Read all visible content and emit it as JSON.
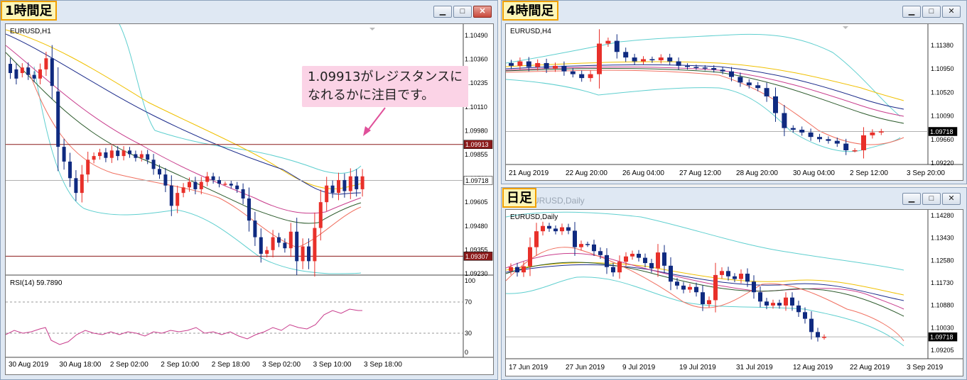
{
  "windows": {
    "h1": {
      "label": "1時間足",
      "symbol": "EURUSD,H1",
      "rsi_label": "RSI(14) 59.7890",
      "price_ticks": [
        "1.10490",
        "1.10360",
        "1.10235",
        "1.10110",
        "1.09980",
        "1.09855",
        "1.09730",
        "1.09605",
        "1.09480",
        "1.09355",
        "1.09230"
      ],
      "resistance_tag": "1.09913",
      "support_tag": "1.09307",
      "current_tag": "1.09718",
      "rsi_ticks": [
        "100",
        "70",
        "30",
        "0"
      ],
      "time_ticks": [
        "30 Aug 2019",
        "30 Aug 18:00",
        "2 Sep 02:00",
        "2 Sep 10:00",
        "2 Sep 18:00",
        "3 Sep 02:00",
        "3 Sep 10:00",
        "3 Sep 18:00"
      ],
      "callout": "1.09913がレジスタンスに\nなれるかに注目です。"
    },
    "h4": {
      "label": "4時間足",
      "symbol": "EURUSD,H4",
      "price_ticks": [
        "1.11380",
        "1.10950",
        "1.10520",
        "1.10090",
        "1.09660",
        "1.09220"
      ],
      "current_tag": "1.09718",
      "time_ticks": [
        "21 Aug 2019",
        "22 Aug 20:00",
        "26 Aug 04:00",
        "27 Aug 12:00",
        "28 Aug 20:00",
        "30 Aug 04:00",
        "2 Sep 12:00",
        "3 Sep 20:00"
      ]
    },
    "daily": {
      "label": "日足",
      "ghost_title": "EURUSD,Daily",
      "symbol": "EURUSD,Daily",
      "price_ticks": [
        "1.14280",
        "1.13430",
        "1.12580",
        "1.11730",
        "1.10880",
        "1.10030",
        "1.09205"
      ],
      "current_tag": "1.09718",
      "time_ticks": [
        "17 Jun 2019",
        "27 Jun 2019",
        "9 Jul 2019",
        "19 Jul 2019",
        "31 Jul 2019",
        "12 Aug 2019",
        "22 Aug 2019",
        "3 Sep 2019"
      ]
    }
  },
  "buttons": {
    "minimize": "▁",
    "maximize": "□",
    "close": "✕"
  },
  "colors": {
    "bull": "#e8302a",
    "bear": "#0f2a80",
    "resistance": "#8b1a1a",
    "callout_bg": "#fbd3e6",
    "label_bg": "#fdf6b8",
    "label_border": "#f0a000"
  },
  "chart_data": [
    {
      "type": "candlestick",
      "name": "EURUSD,H1",
      "ylim": [
        1.0922,
        1.1055
      ],
      "hlines": [
        1.09913,
        1.09307,
        1.09718
      ],
      "candles": [
        [
          1.1035,
          1.103
        ],
        [
          1.1032,
          1.1027
        ],
        [
          1.103,
          1.1033
        ],
        [
          1.1033,
          1.1029
        ],
        [
          1.1029,
          1.1027
        ],
        [
          1.1027,
          1.1032
        ],
        [
          1.1032,
          1.1038
        ],
        [
          1.1038,
          1.1023
        ],
        [
          1.102,
          1.099
        ],
        [
          1.099,
          1.0982
        ],
        [
          1.0982,
          1.0973
        ],
        [
          1.0973,
          1.0965
        ],
        [
          1.0965,
          1.0975
        ],
        [
          1.0975,
          1.0983
        ],
        [
          1.0983,
          1.0985
        ],
        [
          1.0985,
          1.0987
        ],
        [
          1.0987,
          1.0984
        ],
        [
          1.0984,
          1.0988
        ],
        [
          1.0988,
          1.0985
        ],
        [
          1.0985,
          1.0988
        ],
        [
          1.0988,
          1.0986
        ],
        [
          1.0986,
          1.0984
        ],
        [
          1.0984,
          1.0986
        ],
        [
          1.0986,
          1.0983
        ],
        [
          1.0983,
          1.0978
        ],
        [
          1.0978,
          1.0975
        ],
        [
          1.0975,
          1.0969
        ],
        [
          1.0969,
          1.0958
        ],
        [
          1.0958,
          1.0965
        ],
        [
          1.0965,
          1.0968
        ],
        [
          1.0968,
          1.0971
        ],
        [
          1.0971,
          1.0967
        ],
        [
          1.0967,
          1.0971
        ],
        [
          1.0971,
          1.0974
        ],
        [
          1.0974,
          1.0972
        ],
        [
          1.0972,
          1.097
        ],
        [
          1.097,
          1.097
        ],
        [
          1.097,
          1.0969
        ],
        [
          1.0969,
          1.0967
        ],
        [
          1.0967,
          1.0962
        ],
        [
          1.0962,
          1.095
        ],
        [
          1.095,
          1.0941
        ],
        [
          1.0941,
          1.0932
        ],
        [
          1.0932,
          1.0934
        ],
        [
          1.0934,
          1.0941
        ],
        [
          1.0941,
          1.0938
        ],
        [
          1.0938,
          1.0935
        ],
        [
          1.0935,
          1.0944
        ],
        [
          1.0944,
          1.0928
        ],
        [
          1.0928,
          1.0936
        ],
        [
          1.0936,
          1.0928
        ],
        [
          1.0928,
          1.0946
        ],
        [
          1.0946,
          1.096
        ],
        [
          1.096,
          1.0969
        ],
        [
          1.0969,
          1.0965
        ],
        [
          1.0965,
          1.0972
        ],
        [
          1.0972,
          1.0966
        ],
        [
          1.0966,
          1.0974
        ],
        [
          1.0974,
          1.0967
        ],
        [
          1.0967,
          1.0974
        ]
      ]
    },
    {
      "type": "candlestick",
      "name": "EURUSD,H4",
      "ylim": [
        1.0915,
        1.116
      ],
      "hlines": [
        1.09718
      ],
      "candles": [
        [
          1.1095,
          1.109
        ],
        [
          1.109,
          1.1098
        ],
        [
          1.1098,
          1.1088
        ],
        [
          1.1088,
          1.1095
        ],
        [
          1.1095,
          1.1085
        ],
        [
          1.1085,
          1.109
        ],
        [
          1.109,
          1.108
        ],
        [
          1.108,
          1.1075
        ],
        [
          1.1075,
          1.1068
        ],
        [
          1.1068,
          1.1075
        ],
        [
          1.1075,
          1.113
        ],
        [
          1.113,
          1.1135
        ],
        [
          1.1135,
          1.1115
        ],
        [
          1.1115,
          1.1105
        ],
        [
          1.1105,
          1.1098
        ],
        [
          1.1098,
          1.1102
        ],
        [
          1.1102,
          1.11
        ],
        [
          1.11,
          1.1105
        ],
        [
          1.1105,
          1.1098
        ],
        [
          1.1098,
          1.109
        ],
        [
          1.109,
          1.1088
        ],
        [
          1.1088,
          1.1087
        ],
        [
          1.1087,
          1.1086
        ],
        [
          1.1086,
          1.1083
        ],
        [
          1.1083,
          1.108
        ],
        [
          1.108,
          1.107
        ],
        [
          1.107,
          1.106
        ],
        [
          1.106,
          1.1055
        ],
        [
          1.1055,
          1.105
        ],
        [
          1.105,
          1.1035
        ],
        [
          1.1035,
          1.1005
        ],
        [
          1.1005,
          1.0978
        ],
        [
          1.0978,
          1.0975
        ],
        [
          1.0975,
          1.097
        ],
        [
          1.097,
          1.0962
        ],
        [
          1.0962,
          1.0958
        ],
        [
          1.0958,
          1.0955
        ],
        [
          1.0955,
          1.095
        ],
        [
          1.095,
          1.0938
        ],
        [
          1.0938,
          1.0938
        ],
        [
          1.0938,
          1.0965
        ],
        [
          1.0965,
          1.097
        ],
        [
          1.097,
          1.0972
        ]
      ]
    },
    {
      "type": "candlestick",
      "name": "EURUSD,Daily",
      "ylim": [
        1.09,
        1.144
      ],
      "hlines": [
        1.09718
      ],
      "candles": [
        [
          1.122,
          1.1235
        ],
        [
          1.1235,
          1.1215
        ],
        [
          1.1215,
          1.1238
        ],
        [
          1.1238,
          1.131
        ],
        [
          1.131,
          1.137
        ],
        [
          1.137,
          1.139
        ],
        [
          1.139,
          1.138
        ],
        [
          1.138,
          1.137
        ],
        [
          1.137,
          1.1385
        ],
        [
          1.1385,
          1.1372
        ],
        [
          1.1372,
          1.131
        ],
        [
          1.131,
          1.1322
        ],
        [
          1.1322,
          1.132
        ],
        [
          1.132,
          1.1295
        ],
        [
          1.1295,
          1.128
        ],
        [
          1.128,
          1.1235
        ],
        [
          1.1235,
          1.1215
        ],
        [
          1.1215,
          1.1255
        ],
        [
          1.1255,
          1.1275
        ],
        [
          1.1275,
          1.1285
        ],
        [
          1.1285,
          1.127
        ],
        [
          1.127,
          1.125
        ],
        [
          1.125,
          1.123
        ],
        [
          1.123,
          1.129
        ],
        [
          1.129,
          1.124
        ],
        [
          1.124,
          1.118
        ],
        [
          1.118,
          1.1165
        ],
        [
          1.1165,
          1.115
        ],
        [
          1.115,
          1.116
        ],
        [
          1.116,
          1.114
        ],
        [
          1.114,
          1.1095
        ],
        [
          1.1095,
          1.111
        ],
        [
          1.111,
          1.1205
        ],
        [
          1.1205,
          1.122
        ],
        [
          1.122,
          1.12
        ],
        [
          1.12,
          1.119
        ],
        [
          1.119,
          1.121
        ],
        [
          1.121,
          1.118
        ],
        [
          1.118,
          1.114
        ],
        [
          1.114,
          1.1105
        ],
        [
          1.1105,
          1.109
        ],
        [
          1.109,
          1.11
        ],
        [
          1.11,
          1.109
        ],
        [
          1.109,
          1.112
        ],
        [
          1.112,
          1.109
        ],
        [
          1.109,
          1.1065
        ],
        [
          1.1065,
          1.104
        ],
        [
          1.104,
          1.099
        ],
        [
          1.099,
          1.097
        ],
        [
          1.097,
          1.0972
        ]
      ]
    }
  ]
}
